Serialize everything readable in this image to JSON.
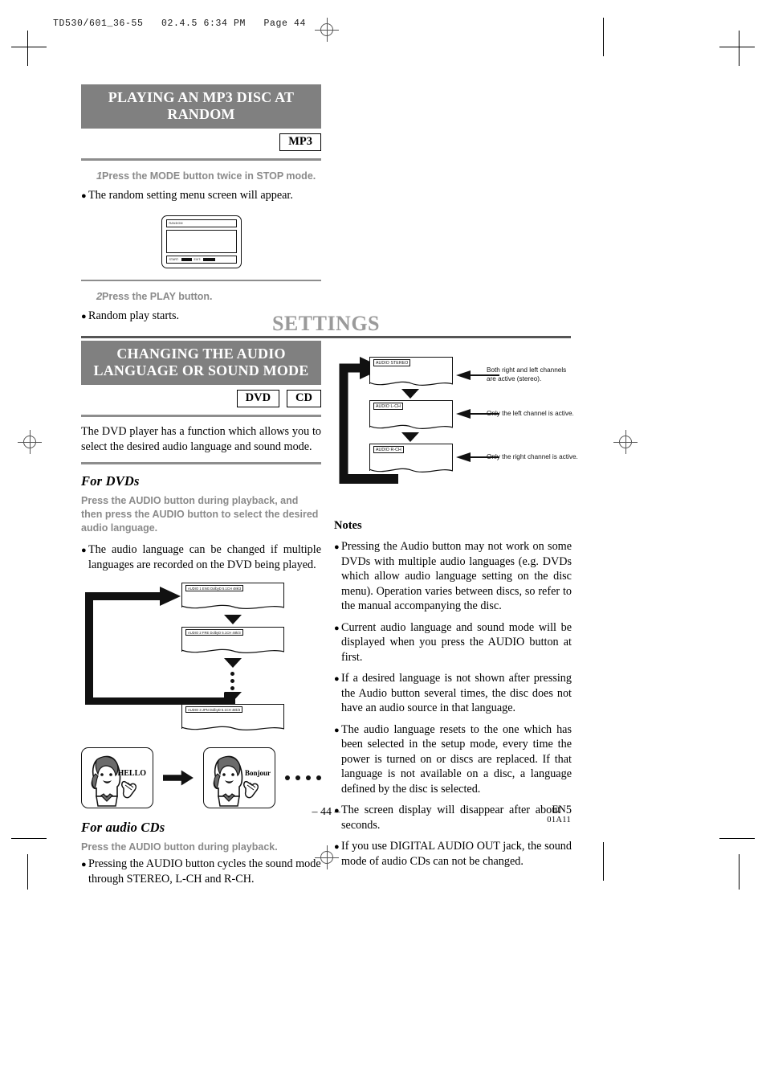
{
  "runhead": "TD530/601_36-55   02.4.5 6:34 PM   Page 44",
  "section1": {
    "banner": "PLAYING AN MP3 DISC AT RANDOM",
    "badges": [
      "MP3"
    ],
    "steps": [
      {
        "num": "1",
        "text": "Press the MODE button twice in STOP mode."
      },
      {
        "num": "2",
        "text": "Press the PLAY button."
      }
    ],
    "bullet1": "The random setting menu screen will appear.",
    "bullet2": "Random play starts.",
    "osd": {
      "title": "RANDOM",
      "start_label": "START:",
      "start_key": "PLAY",
      "exit_label": "EXIT:",
      "exit_key": "MODE"
    }
  },
  "settings": {
    "title": "SETTINGS",
    "banner": "CHANGING THE AUDIO LANGUAGE OR SOUND MODE",
    "badges": [
      "DVD",
      "CD"
    ],
    "intro": "The DVD player has a function which allows you to select the desired audio language and sound mode.",
    "for_dvds": {
      "heading": "For DVDs",
      "instruction": "Press the AUDIO button during playback, and then press the AUDIO button to select the desired audio language.",
      "bullet": "The audio language can be changed if multiple languages are recorded on the DVD being played.",
      "flow": [
        "AUDIO 1 ENG DolbyD 5.1CH 48k/3",
        "AUDIO 2 FRE DolbyD 5.1CH 48k/3",
        "AUDIO 3 JPN DolbyD 5.1CH 48k/3"
      ],
      "people": [
        {
          "word": "HELLO"
        },
        {
          "word": "Bonjour"
        }
      ]
    },
    "for_cds": {
      "heading": "For audio CDs",
      "instruction": "Press the AUDIO button during playback.",
      "bullet": "Pressing the AUDIO button cycles the sound mode through STEREO, L-CH and R-CH."
    },
    "sound_flow": [
      {
        "label": "AUDIO STEREO",
        "callout": "Both right and left channels are active (stereo)."
      },
      {
        "label": "AUDIO L-CH",
        "callout": "Only the left channel is active."
      },
      {
        "label": "AUDIO R-CH",
        "callout": "Only the right channel is active."
      }
    ]
  },
  "notes": {
    "title": "Notes",
    "items": [
      "Pressing the Audio button may not work on some DVDs with multiple audio languages (e.g. DVDs which allow audio language setting on the disc menu). Operation varies between discs, so refer to the manual accompanying the disc.",
      "Current audio language and sound mode will be displayed when you press the AUDIO button at first.",
      "If a desired language is not shown after pressing the Audio button several times, the disc does not have an audio source in that language.",
      "The audio language resets to the one which has been selected in the setup mode, every time the power is turned on or discs are replaced. If that language is not available on a disc, a language defined by the disc is selected.",
      "The screen display will disappear after about 5 seconds.",
      "If you use DIGITAL AUDIO OUT jack, the sound mode of audio CDs can not be changed."
    ]
  },
  "footer": {
    "page": "– 44 –",
    "lang": "EN",
    "code": "01A11"
  },
  "colors": {
    "banner_bg": "#808080",
    "rule": "#8d8d8d",
    "muted_text": "#8a8a8a"
  }
}
